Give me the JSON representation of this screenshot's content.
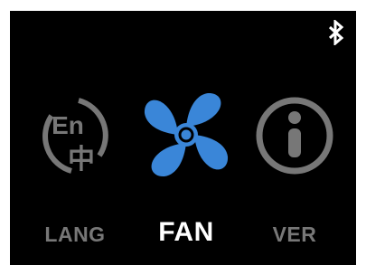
{
  "status_bar": {
    "bluetooth_icon": "bluetooth-icon"
  },
  "menu": {
    "items": [
      {
        "id": "lang",
        "label": "LANG",
        "icon": "language-en-zh-icon",
        "glyph_en": "En",
        "glyph_zh": "中",
        "active": false
      },
      {
        "id": "fan",
        "label": "FAN",
        "icon": "fan-icon",
        "active": true
      },
      {
        "id": "ver",
        "label": "VER",
        "icon": "info-icon",
        "active": false
      }
    ]
  },
  "colors": {
    "background": "#000000",
    "accent": "#3a86d8",
    "inactive": "#777777",
    "active_label": "#ffffff"
  }
}
